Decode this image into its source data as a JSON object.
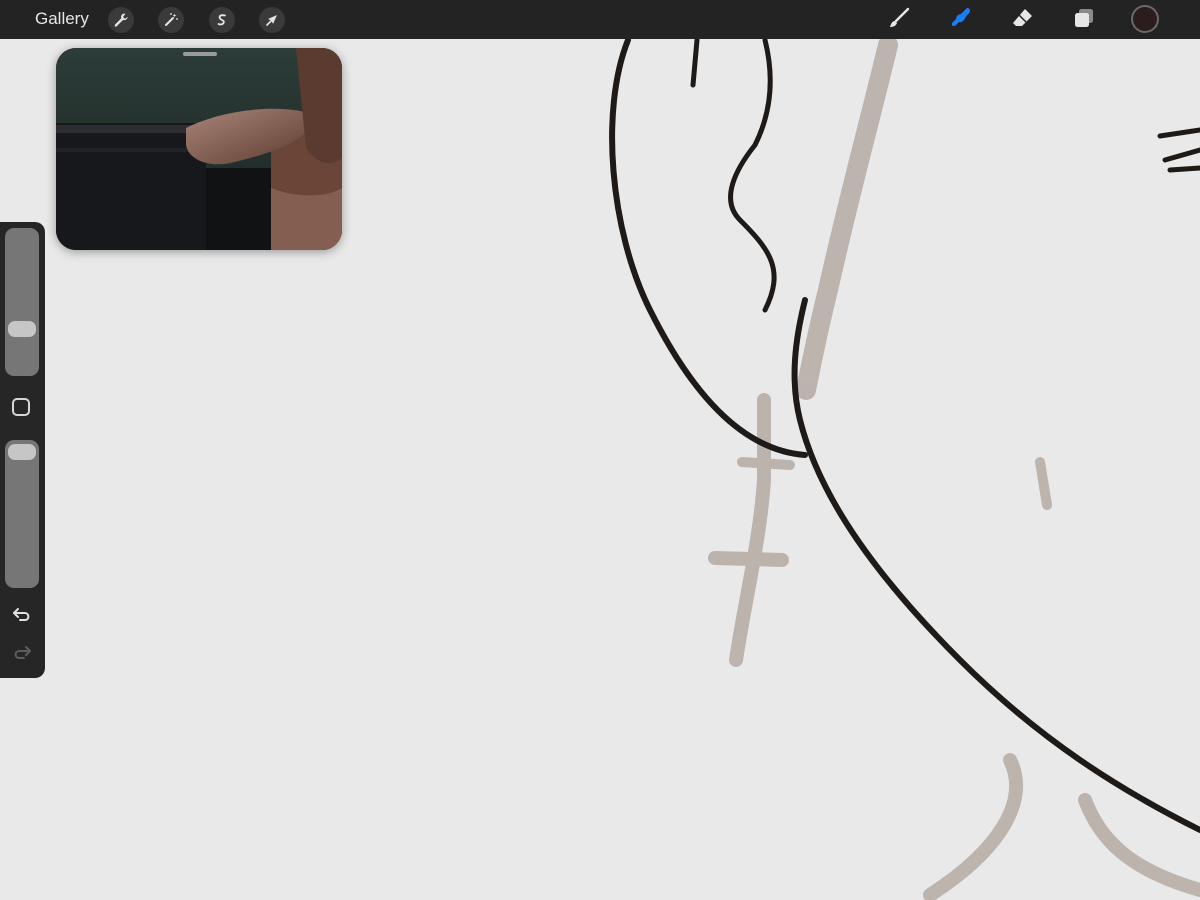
{
  "toolbar": {
    "gallery_label": "Gallery",
    "left_tools": [
      {
        "name": "actions",
        "icon": "wrench-icon"
      },
      {
        "name": "adjustments",
        "icon": "magic-wand-icon"
      },
      {
        "name": "selection",
        "icon": "selection-s-icon"
      },
      {
        "name": "transform",
        "icon": "arrow-cursor-icon"
      }
    ],
    "right_tools": [
      {
        "name": "brush",
        "icon": "brush-icon",
        "active": false
      },
      {
        "name": "smudge",
        "icon": "smudge-finger-icon",
        "active": true
      },
      {
        "name": "eraser",
        "icon": "eraser-icon",
        "active": false
      },
      {
        "name": "layers",
        "icon": "layers-icon",
        "active": false
      }
    ],
    "current_color": "#2b1d1b",
    "active_tool_color": "#1a7cf6",
    "icon_color": "#e6e6e6"
  },
  "sidebar": {
    "brush_size_level": 0.72,
    "opacity_level": 0.0,
    "modify_button_icon": "square-icon",
    "undo_icon": "undo-icon",
    "redo_icon": "redo-icon",
    "redo_enabled": false
  },
  "reference_window": {
    "content": "photo-reference"
  },
  "canvas": {
    "background_color": "#e9e9e9",
    "ink_color": "#1e1a17",
    "sketch_color": "#b4aaa2"
  }
}
